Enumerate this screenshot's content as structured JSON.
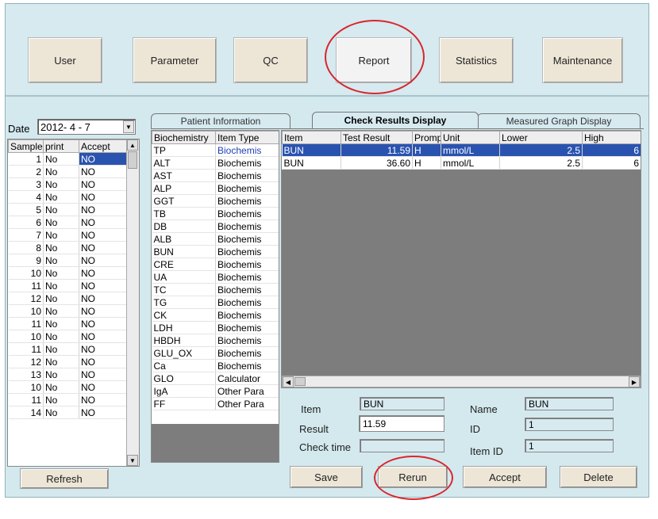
{
  "toolbar": {
    "buttons": [
      "User",
      "Parameter",
      "QC",
      "Report",
      "Statistics",
      "Maintenance"
    ]
  },
  "date": {
    "label": "Date",
    "value": "2012- 4 - 7"
  },
  "samples": {
    "headers": [
      "Sample",
      "print",
      "Accept"
    ],
    "rows": [
      [
        "1",
        "No",
        "NO"
      ],
      [
        "2",
        "No",
        "NO"
      ],
      [
        "3",
        "No",
        "NO"
      ],
      [
        "4",
        "No",
        "NO"
      ],
      [
        "5",
        "No",
        "NO"
      ],
      [
        "6",
        "No",
        "NO"
      ],
      [
        "7",
        "No",
        "NO"
      ],
      [
        "8",
        "No",
        "NO"
      ],
      [
        "9",
        "No",
        "NO"
      ],
      [
        "10",
        "No",
        "NO"
      ],
      [
        "11",
        "No",
        "NO"
      ],
      [
        "12",
        "No",
        "NO"
      ],
      [
        "10",
        "No",
        "NO"
      ],
      [
        "11",
        "No",
        "NO"
      ],
      [
        "10",
        "No",
        "NO"
      ],
      [
        "11",
        "No",
        "NO"
      ],
      [
        "12",
        "No",
        "NO"
      ],
      [
        "13",
        "No",
        "NO"
      ],
      [
        "10",
        "No",
        "NO"
      ],
      [
        "11",
        "No",
        "NO"
      ],
      [
        "14",
        "No",
        "NO"
      ]
    ]
  },
  "refresh_label": "Refresh",
  "tabs": [
    "Patient Information",
    "Check Results Display",
    "Measured Graph Display"
  ],
  "items": {
    "headers": [
      "Biochemistry",
      "Item Type"
    ],
    "rows": [
      [
        "TP",
        "Biochemis"
      ],
      [
        "ALT",
        "Biochemis"
      ],
      [
        "AST",
        "Biochemis"
      ],
      [
        "ALP",
        "Biochemis"
      ],
      [
        "GGT",
        "Biochemis"
      ],
      [
        "TB",
        "Biochemis"
      ],
      [
        "DB",
        "Biochemis"
      ],
      [
        "ALB",
        "Biochemis"
      ],
      [
        "BUN",
        "Biochemis"
      ],
      [
        "CRE",
        "Biochemis"
      ],
      [
        "UA",
        "Biochemis"
      ],
      [
        "TC",
        "Biochemis"
      ],
      [
        "TG",
        "Biochemis"
      ],
      [
        "CK",
        "Biochemis"
      ],
      [
        "LDH",
        "Biochemis"
      ],
      [
        "HBDH",
        "Biochemis"
      ],
      [
        "GLU_OX",
        "Biochemis"
      ],
      [
        "Ca",
        "Biochemis"
      ],
      [
        "GLO",
        "Calculator"
      ],
      [
        "IgA",
        "Other Para"
      ],
      [
        "FF",
        "Other Para"
      ]
    ]
  },
  "results": {
    "headers": [
      "Item",
      "Test Result",
      "Promp",
      "Unit",
      "Lower",
      "High"
    ],
    "rows": [
      [
        "BUN",
        "11.59",
        "H",
        "mmol/L",
        "2.5",
        "6"
      ],
      [
        "BUN",
        "36.60",
        "H",
        "mmol/L",
        "2.5",
        "6"
      ]
    ]
  },
  "detail": {
    "item_label": "Item",
    "item_value": "BUN",
    "name_label": "Name",
    "name_value": "BUN",
    "result_label": "Result",
    "result_value": "11.59",
    "id_label": "ID",
    "id_value": "1",
    "checktime_label": "Check time",
    "checktime_value": "",
    "itemid_label": "Item ID",
    "itemid_value": "1"
  },
  "actions": {
    "save": "Save",
    "rerun": "Rerun",
    "accept": "Accept",
    "delete": "Delete"
  },
  "colors": {
    "highlight_ring": "#d9262c",
    "selection": "#2a53b0",
    "panel": "#d6eaf0"
  }
}
